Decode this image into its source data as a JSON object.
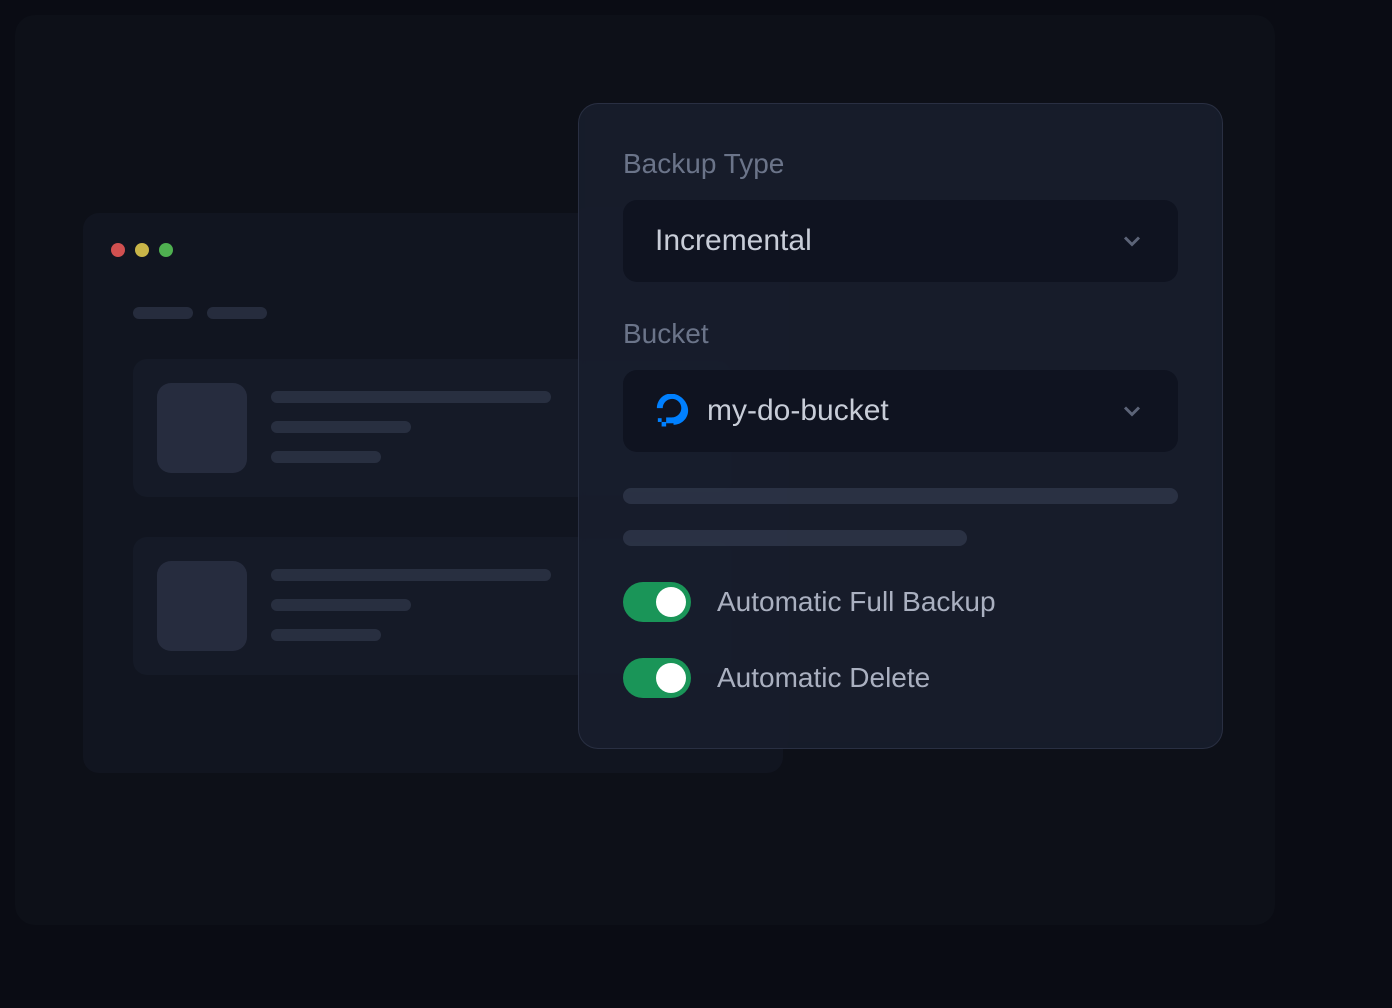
{
  "panel": {
    "backup_type_label": "Backup Type",
    "backup_type_value": "Incremental",
    "bucket_label": "Bucket",
    "bucket_value": "my-do-bucket",
    "toggles": {
      "auto_full_backup": {
        "label": "Automatic Full Backup",
        "enabled": true
      },
      "auto_delete": {
        "label": "Automatic Delete",
        "enabled": true
      }
    }
  }
}
